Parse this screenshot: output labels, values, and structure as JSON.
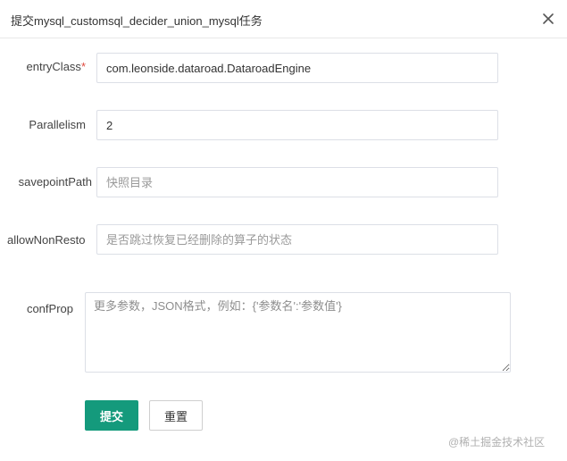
{
  "dialog": {
    "title": "提交mysql_customsql_decider_union_mysql任务",
    "close_icon": "close-icon"
  },
  "form": {
    "entry_class": {
      "label": "entryClass",
      "required_mark": "*",
      "value": "com.leonside.dataroad.DataroadEngine"
    },
    "parallelism": {
      "label": "Parallelism",
      "value": "2"
    },
    "savepoint_path": {
      "label": "savepointPath",
      "placeholder": "快照目录"
    },
    "allow_non_restored": {
      "label": "allowNonResto",
      "placeholder": "是否跳过恢复已经删除的算子的状态"
    },
    "conf_prop": {
      "label": "confProp",
      "placeholder": "更多参数，JSON格式，例如：{'参数名':'参数值'}"
    }
  },
  "buttons": {
    "submit_label": "提交",
    "reset_label": "重置"
  },
  "watermark": "@稀土掘金技术社区",
  "colors": {
    "primary": "#149a7c",
    "required": "#e04a3f",
    "border": "#dcdfe6"
  }
}
